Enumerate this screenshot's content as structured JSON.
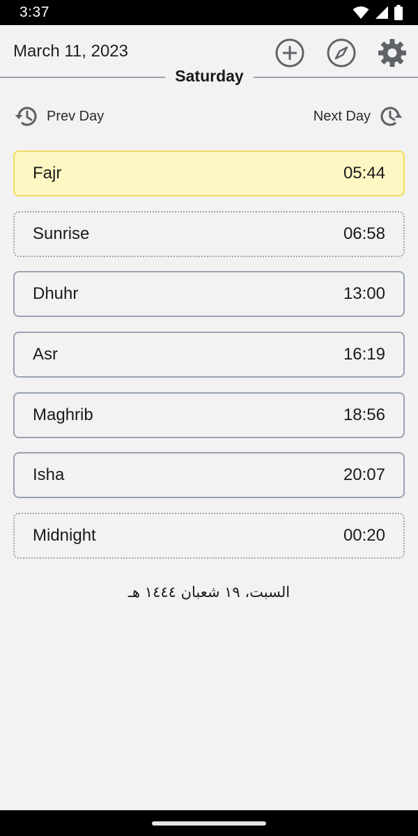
{
  "status_bar": {
    "time": "3:37",
    "icons": [
      "wifi-icon",
      "signal-icon",
      "battery-icon"
    ]
  },
  "header": {
    "date": "March 11, 2023",
    "actions": [
      "add-icon",
      "compass-icon",
      "gear-icon"
    ]
  },
  "day": {
    "name": "Saturday"
  },
  "navigation": {
    "prev_label": "Prev Day",
    "next_label": "Next Day"
  },
  "prayers": [
    {
      "name": "Fajr",
      "time": "05:44",
      "state": "current"
    },
    {
      "name": "Sunrise",
      "time": "06:58",
      "state": "optional"
    },
    {
      "name": "Dhuhr",
      "time": "13:00",
      "state": "normal"
    },
    {
      "name": "Asr",
      "time": "16:19",
      "state": "normal"
    },
    {
      "name": "Maghrib",
      "time": "18:56",
      "state": "normal"
    },
    {
      "name": "Isha",
      "time": "20:07",
      "state": "normal"
    },
    {
      "name": "Midnight",
      "time": "00:20",
      "state": "optional"
    }
  ],
  "hijri_date": "السبت، ١٩ شعبان ١٤٤٤ هـ",
  "colors": {
    "background": "#f2f2f2",
    "card_border": "#9aa3b0",
    "current_fill": "#fef7c3",
    "current_border": "#f2dc5d",
    "icon": "#5f6368"
  }
}
